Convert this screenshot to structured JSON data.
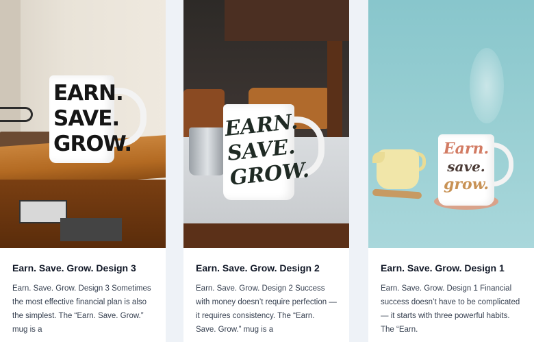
{
  "cards": [
    {
      "title": "Earn. Save. Grow. Design 3",
      "excerpt": "Earn. Save. Grow. Design 3 Sometimes the most effective financial plan is also the simplest. The “Earn. Save. Grow.” mug is a",
      "mug_lines": [
        "EARN.",
        "SAVE.",
        "GROW."
      ]
    },
    {
      "title": "Earn. Save. Grow. Design 2",
      "excerpt": "Earn. Save. Grow. Design 2 Success with money doesn’t require perfection — it requires consistency. The “Earn. Save. Grow.” mug is a",
      "mug_lines": [
        "EARN.",
        "SAVE.",
        "GROW."
      ]
    },
    {
      "title": "Earn. Save. Grow. Design 1",
      "excerpt": "Earn. Save. Grow. Design 1 Financial success doesn’t have to be complicated — it starts with three powerful habits. The “Earn.",
      "mug_lines": [
        "Earn.",
        "save.",
        "grow."
      ]
    }
  ],
  "colors": {
    "page_background": "#eef2f7",
    "card_background": "#ffffff",
    "title_text": "#111827",
    "body_text": "#374151"
  }
}
